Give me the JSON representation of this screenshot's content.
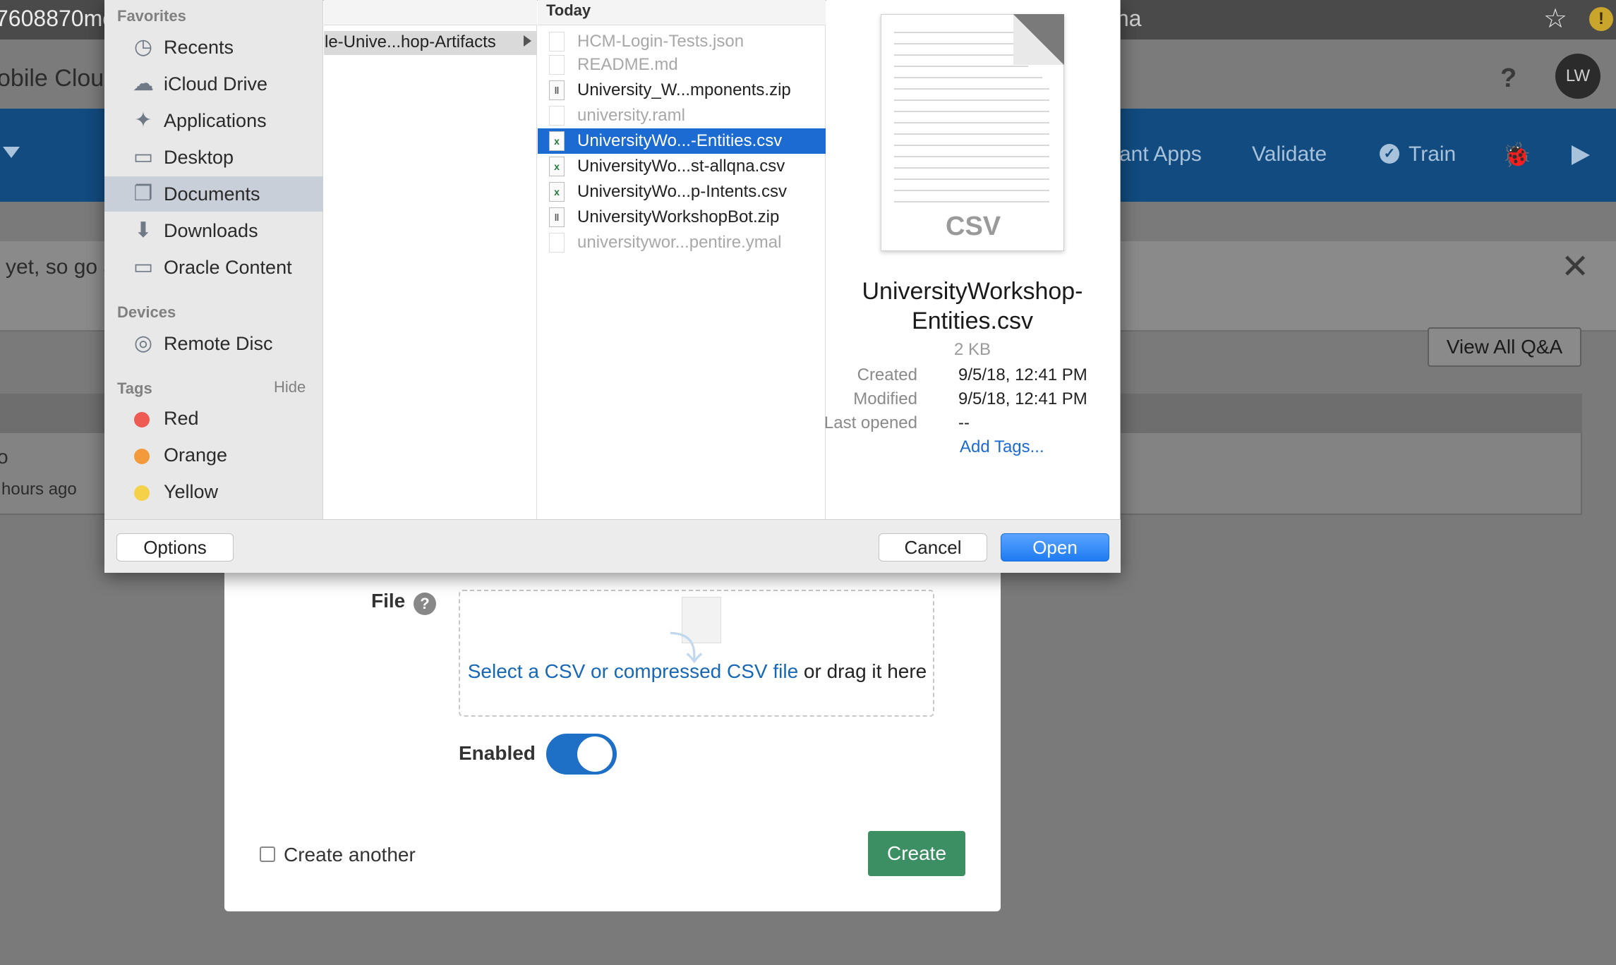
{
  "browser": {
    "url_left": "7608870mo",
    "url_right": "na"
  },
  "app": {
    "title": "obile Cloud",
    "avatar_initials": "LW",
    "help_glyph": "?",
    "toolbar": {
      "items": [
        "ant Apps",
        "Validate",
        "Train"
      ]
    },
    "banner_text": "yet, so go a",
    "view_all_qa": "View All Q&A",
    "row_title": "o",
    "row_time": "hours ago"
  },
  "create_form": {
    "file_label": "File",
    "dropzone_link": "Select a CSV or compressed CSV file",
    "dropzone_suffix": " or drag it here",
    "enabled_label": "Enabled",
    "enabled": true,
    "create_another_label": "Create another",
    "create_another_checked": false,
    "create_button": "Create"
  },
  "file_dialog": {
    "sidebar": {
      "favorites_header": "Favorites",
      "favorites": [
        {
          "label": "Recents",
          "icon": "clock-icon"
        },
        {
          "label": "iCloud Drive",
          "icon": "cloud-icon"
        },
        {
          "label": "Applications",
          "icon": "applications-icon"
        },
        {
          "label": "Desktop",
          "icon": "desktop-icon"
        },
        {
          "label": "Documents",
          "icon": "documents-icon",
          "selected": true
        },
        {
          "label": "Downloads",
          "icon": "downloads-icon"
        },
        {
          "label": "Oracle Content",
          "icon": "folder-icon"
        }
      ],
      "devices_header": "Devices",
      "devices": [
        {
          "label": "Remote Disc",
          "icon": "disc-icon"
        }
      ],
      "tags_header": "Tags",
      "tags_hide": "Hide",
      "tags": [
        {
          "label": "Red",
          "color": "#ee5b52"
        },
        {
          "label": "Orange",
          "color": "#f39b3c"
        },
        {
          "label": "Yellow",
          "color": "#f5d049"
        }
      ]
    },
    "column1": {
      "selected_folder": "le-Unive...hop-Artifacts"
    },
    "column2": {
      "header": "Today",
      "files": [
        {
          "name": "HCM-Login-Tests.json",
          "dim": true,
          "icon": "doc-icon"
        },
        {
          "name": "README.md",
          "dim": true,
          "icon": "doc-icon"
        },
        {
          "name": "University_W...mponents.zip",
          "dim": false,
          "icon": "zip-icon"
        },
        {
          "name": "university.raml",
          "dim": true,
          "icon": "doc-icon"
        },
        {
          "name": "UniversityWo...-Entities.csv",
          "dim": false,
          "icon": "excel-icon",
          "selected": true
        },
        {
          "name": "UniversityWo...st-allqna.csv",
          "dim": false,
          "icon": "excel-icon"
        },
        {
          "name": "UniversityWo...p-Intents.csv",
          "dim": false,
          "icon": "excel-icon"
        },
        {
          "name": "UniversityWorkshopBot.zip",
          "dim": false,
          "icon": "zip-icon"
        },
        {
          "name": "universitywor...pentire.ymal",
          "dim": true,
          "icon": "doc-icon"
        }
      ]
    },
    "preview": {
      "thumb_label": "CSV",
      "name_line1": "UniversityWorkshop-",
      "name_line2": "Entities.csv",
      "size": "2 KB",
      "created_label": "Created",
      "created": "9/5/18, 12:41 PM",
      "modified_label": "Modified",
      "modified": "9/5/18, 12:41 PM",
      "last_opened_label": "Last opened",
      "last_opened": "--",
      "add_tags": "Add Tags..."
    },
    "buttons": {
      "options": "Options",
      "cancel": "Cancel",
      "open": "Open"
    }
  }
}
